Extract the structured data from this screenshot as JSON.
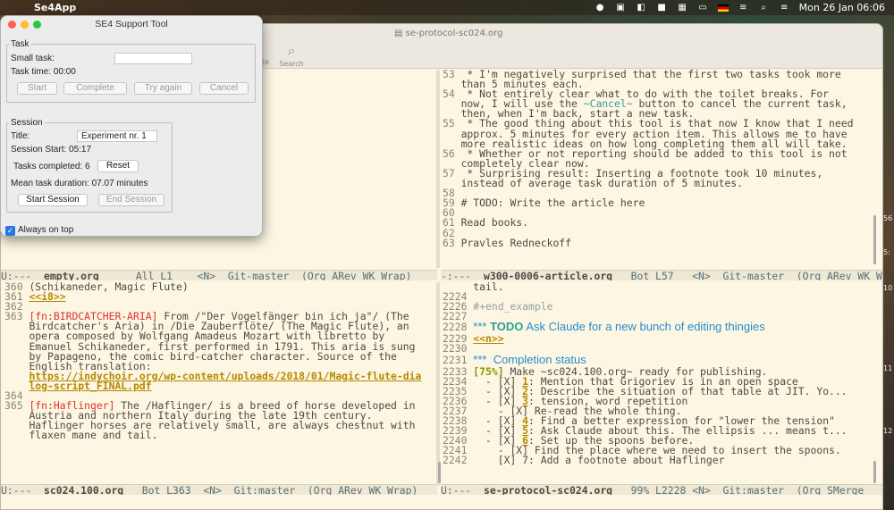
{
  "menubar": {
    "app_name": "Se4App",
    "clock": "Mon 26 Jan  06:06"
  },
  "desktop": {
    "edge_labels": [
      "56",
      "5:",
      "10",
      "11",
      "12"
    ]
  },
  "emacs": {
    "window_title": "se-protocol-sc024.org",
    "toolbar_search": "Search",
    "toolbar_partial": "te",
    "top_right_lines": [
      {
        "n": "53",
        "t": " * I'm negatively surprised that the first two tasks took more"
      },
      {
        "n": "",
        "t": "than 5 minutes each."
      },
      {
        "n": "54",
        "t": " * Not entirely clear what to do with the toilet breaks. For"
      },
      {
        "n": "",
        "t": "now, I will use the ",
        "code": "~Cancel~",
        "t2": " button to cancel the current task,"
      },
      {
        "n": "",
        "t": "then, when I'm back, start a new task."
      },
      {
        "n": "55",
        "t": " * The good thing about this tool is that now I know that I need"
      },
      {
        "n": "",
        "t": "approx. 5 minutes for every action item. This allows me to have"
      },
      {
        "n": "",
        "t": "more realistic ideas on how long completing them all will take."
      },
      {
        "n": "56",
        "t": " * Whether or not reporting should be added to this tool is not"
      },
      {
        "n": "",
        "t": "completely clear now."
      },
      {
        "n": "57",
        "t": " * Surprising result: Inserting a footnote took 10 minutes,"
      },
      {
        "n": "",
        "t": "instead of average task duration of 5 minutes."
      },
      {
        "n": "58",
        "t": ""
      },
      {
        "n": "59",
        "t": "# TODO: Write the article here"
      },
      {
        "n": "60",
        "t": ""
      },
      {
        "n": "61",
        "t": "Read books."
      },
      {
        "n": "62",
        "t": ""
      },
      {
        "n": "63",
        "t": "Pravles Redneckoff"
      }
    ],
    "modeline_top_left": {
      "status": "U:---  ",
      "buffer": "empty.org",
      "rest": "      All L1    <N>  Git-master  (Org ARev WK Wrap)"
    },
    "modeline_top_right": {
      "status": "-:---  ",
      "buffer": "w300-0006-article.org",
      "rest": "   Bot L57   <N>  Git-master  (Org ARev WK Wrap)"
    },
    "bottom_left_lines": [
      {
        "n": "360",
        "t": "(Schikaneder, Magic Flute)"
      },
      {
        "n": "361",
        "link": "<<i8>>"
      },
      {
        "n": "362",
        "t": ""
      },
      {
        "n": "363",
        "fn": "[fn:BIRDCATCHER-ARIA]",
        "t": " From /\"Der Vogelfänger bin ich ja\"/ (The"
      },
      {
        "n": "",
        "t": "Birdcatcher's Aria) in /Die Zauberflöte/ (The Magic Flute), an"
      },
      {
        "n": "",
        "t": "opera composed by Wolfgang Amadeus Mozart with libretto by"
      },
      {
        "n": "",
        "t": "Emanuel Schikaneder, first performed in 1791. This aria is sung"
      },
      {
        "n": "",
        "t": "by Papageno, the comic bird-catcher character. Source of the"
      },
      {
        "n": "",
        "t": "English translation:"
      },
      {
        "n": "",
        "link": "https://indychoir.org/wp-content/uploads/2018/01/Magic-flute-dia"
      },
      {
        "n": "",
        "link": "log-script_FINAL.pdf"
      },
      {
        "n": "364",
        "t": ""
      },
      {
        "n": "365",
        "fn": "[fn:Haflinger]",
        "t": " The /Haflinger/ is a breed of horse developed in"
      },
      {
        "n": "",
        "t": "Austria and northern Italy during the late 19th century."
      },
      {
        "n": "",
        "t": "Haflinger horses are relatively small, are always chestnut with"
      },
      {
        "n": "",
        "t": "flaxen mane and tail."
      }
    ],
    "bottom_right_lines": [
      {
        "n": "",
        "t": "tail."
      },
      {
        "n": "2224",
        "t": ""
      },
      {
        "n": "2226",
        "t": "#+end_example",
        "grey": true
      },
      {
        "n": "2227",
        "t": ""
      },
      {
        "n": "2228",
        "heading": true,
        "stars": "***",
        "todo": "TODO",
        "t": " Ask Claude for a new bunch of editing thingies"
      },
      {
        "n": "2229",
        "link": "<<n>>"
      },
      {
        "n": "2230",
        "t": ""
      },
      {
        "n": "2231",
        "heading": true,
        "stars": "***",
        "t": " Completion status"
      },
      {
        "n": "2233",
        "pct": "[75%]",
        "t": " Make ~sc024.100.org~ ready for publishing."
      },
      {
        "n": "2234",
        "t": "  - [X] ",
        "num": "1",
        "t2": ": Mention that Grigoriev is in an open space"
      },
      {
        "n": "2235",
        "t": "  - [X] ",
        "num": "2",
        "t2": ": Describe the situation of that table at JIT. Yo..."
      },
      {
        "n": "2236",
        "t": "  - [X] ",
        "num": "3",
        "t2": ": tension, word repetition"
      },
      {
        "n": "2237",
        "t": "    - [X] Re-read the whole thing."
      },
      {
        "n": "2238",
        "t": "  - [X] ",
        "num": "4",
        "t2": ": Find a better expression for \"lower the tension\""
      },
      {
        "n": "2239",
        "t": "  - [X] ",
        "num": "5",
        "t2": ": Ask Claude about this. The ellipsis ... means t..."
      },
      {
        "n": "2240",
        "t": "  - [X] ",
        "num": "6",
        "t2": ": Set up the spoons before."
      },
      {
        "n": "2241",
        "t": "    - [X] Find the place where we need to insert the spoons."
      },
      {
        "n": "2242",
        "t": "    [X] 7: Add a footnote about Haflinger"
      }
    ],
    "modeline_bottom_left": {
      "status": "U:---  ",
      "buffer": "sc024.100.org",
      "rest": "   Bot L363  <N>  Git:master  (Org ARev WK Wrap)"
    },
    "modeline_bottom_right": {
      "status": "U:---  ",
      "buffer": "se-protocol-sc024.org",
      "rest": "   99% L2228 <N>  Git:master  (Org SMerge"
    }
  },
  "dialog": {
    "title": "SE4 Support Tool",
    "task": {
      "legend": "Task",
      "small_task_label": "Small task:",
      "small_task_value": "",
      "task_time_label": "Task time: ",
      "task_time_value": "00:00",
      "buttons": [
        "Start",
        "Complete",
        "Try again",
        "Cancel"
      ]
    },
    "session": {
      "legend": "Session",
      "title_label": "Title:",
      "title_value": "Experiment nr. 1",
      "start_label": "Session Start: ",
      "start_value": "05:17",
      "completed_label": "Tasks completed: ",
      "completed_value": "6",
      "reset_label": "Reset",
      "mean_label": "Mean task duration: ",
      "mean_value": "07.07 minutes",
      "start_session": "Start Session",
      "end_session": "End Session"
    },
    "always_on_top": "Always on top"
  }
}
